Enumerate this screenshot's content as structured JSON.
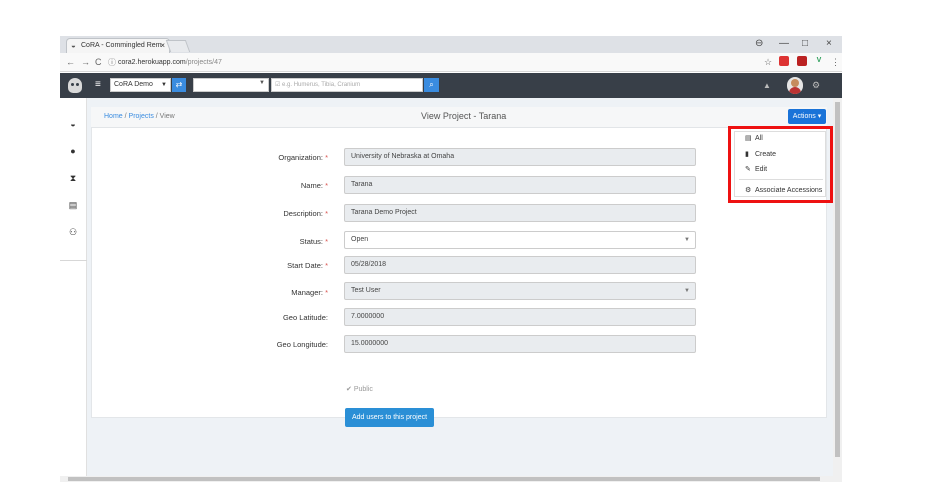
{
  "browser": {
    "tab_title": "CoRA - Commingled Rem",
    "tab_close": "×",
    "window_controls": [
      "⊖",
      "—",
      "□",
      "×"
    ],
    "nav": {
      "back": "←",
      "forward": "→",
      "reload": "C"
    },
    "url_host": "cora2.herokuapp.com",
    "url_path": "/projects/47",
    "info_icon": "ⓘ",
    "star": "☆"
  },
  "appbar": {
    "org_select": "CoRA Demo",
    "search_placeholder": "☑ e.g. Humerus, Tibia, Cranium"
  },
  "breadcrumb": {
    "home": "Home",
    "projects": "Projects",
    "current": "View",
    "sep": " / "
  },
  "page_title": "View Project - Tarana",
  "actions_label": "Actions",
  "form": {
    "organization": {
      "label": "Organization:",
      "value": "University of Nebraska at Omaha"
    },
    "name": {
      "label": "Name:",
      "value": "Tarana"
    },
    "description": {
      "label": "Description:",
      "value": "Tarana Demo Project"
    },
    "status": {
      "label": "Status:",
      "value": "Open"
    },
    "start_date": {
      "label": "Start Date:",
      "value": "05/28/2018"
    },
    "manager": {
      "label": "Manager:",
      "value": "Test User"
    },
    "geo_latitude": {
      "label": "Geo Latitude:",
      "value": "7.0000000"
    },
    "geo_longitude": {
      "label": "Geo Longitude:",
      "value": "15.0000000"
    },
    "required_mark": "*",
    "public_label": "Public",
    "add_users_label": "Add users to this project"
  },
  "actions_menu": {
    "items": [
      {
        "icon": "list-icon",
        "label": "All"
      },
      {
        "icon": "file-icon",
        "label": "Create"
      },
      {
        "icon": "edit-icon",
        "label": "Edit"
      },
      {
        "icon": "cog-icon",
        "label": "Associate Accessions"
      }
    ]
  },
  "highlight_color": "#ee1111",
  "accent_color": "#1a73d8"
}
